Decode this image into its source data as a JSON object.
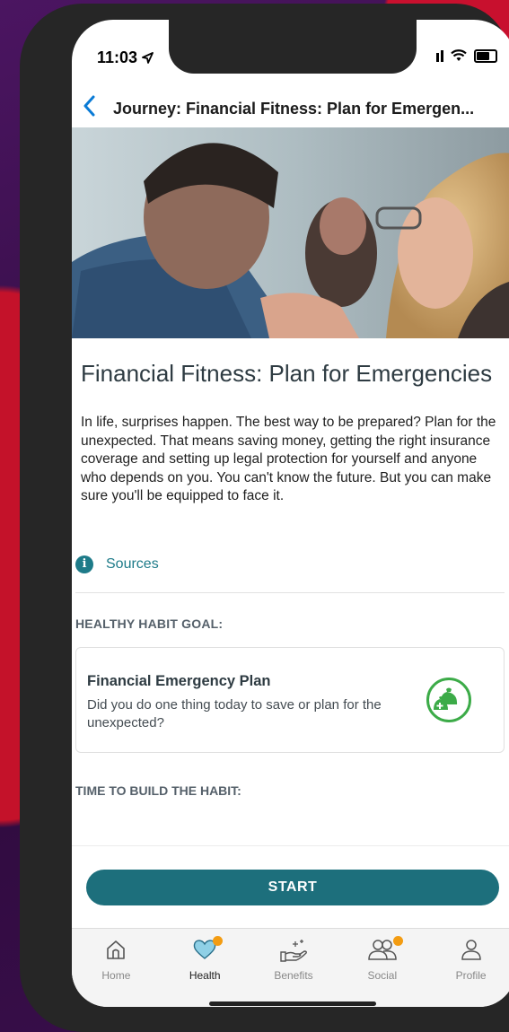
{
  "status_bar": {
    "time": "11:03"
  },
  "header": {
    "back_icon": "chevron-left-icon",
    "title": "Journey: Financial Fitness: Plan for Emergen..."
  },
  "article": {
    "title": "Financial Fitness: Plan for Emergencies",
    "description": "In life, surprises happen. The best way to be prepared? Plan for the unexpected. That means saving money, getting the right insurance coverage and setting up legal protection for yourself and anyone who depends on you. You can't know the future. But you can make sure you'll be equipped to face it.",
    "sources_label": "Sources"
  },
  "habit": {
    "section_label": "HEALTHY HABIT GOAL:",
    "title": "Financial Emergency Plan",
    "question": "Did you do one thing today to save or plan for the unexpected?",
    "icon": "money-bags-icon",
    "time_section_label": "TIME TO BUILD THE HABIT:"
  },
  "start_button": "START",
  "tabs": [
    {
      "label": "Home",
      "icon": "home-icon",
      "active": false,
      "badge": false
    },
    {
      "label": "Health",
      "icon": "heart-icon",
      "active": true,
      "badge": true
    },
    {
      "label": "Benefits",
      "icon": "benefits-hand-icon",
      "active": false,
      "badge": false
    },
    {
      "label": "Social",
      "icon": "people-icon",
      "active": false,
      "badge": true
    },
    {
      "label": "Profile",
      "icon": "person-icon",
      "active": false,
      "badge": false
    }
  ],
  "colors": {
    "accent": "#1d6f7c",
    "link": "#1e7b89",
    "goal_icon": "#3cab48",
    "badge": "#f39c12",
    "back": "#0a7bd6"
  }
}
